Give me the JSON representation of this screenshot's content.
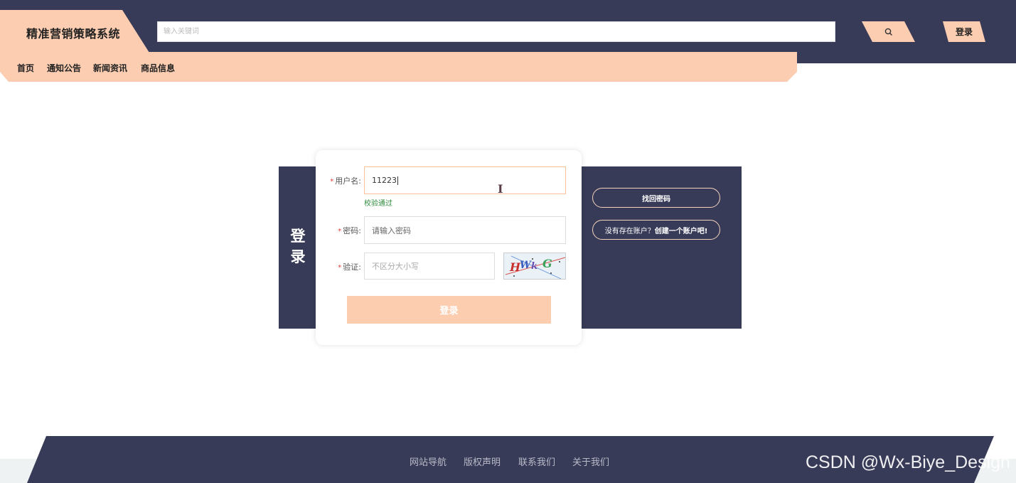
{
  "header": {
    "logo": "精准营销策略系统",
    "search_placeholder": "输入关键词",
    "login_label": "登录"
  },
  "nav": {
    "items": [
      "首页",
      "通知公告",
      "新闻资讯",
      "商品信息"
    ]
  },
  "login_form": {
    "title": "登录",
    "username_label": "用户名:",
    "username_value": "11223",
    "username_status": "校验通过",
    "password_label": "密码:",
    "password_placeholder": "请输入密码",
    "captcha_label": "验证:",
    "captcha_placeholder": "不区分大小写",
    "captcha_text": "HWkG",
    "submit_label": "登录"
  },
  "side_links": {
    "forgot_password": "找回密码",
    "register_prefix": "没有存在账户？",
    "register_link": "创建一个账户吧!"
  },
  "footer": {
    "links": [
      "网站导航",
      "版权声明",
      "联系我们",
      "关于我们"
    ]
  },
  "watermark": "CSDN @Wx-Biye_Design",
  "colors": {
    "dark": "#383b57",
    "accent": "#fccdb1",
    "valid": "#2e8b3e",
    "required": "#e4393c"
  }
}
